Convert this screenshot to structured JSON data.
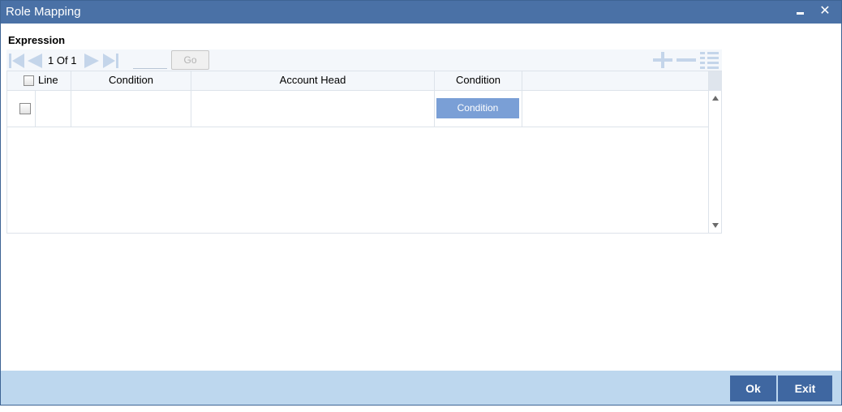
{
  "window": {
    "title": "Role Mapping",
    "minimize_icon": "minimize-icon",
    "close_icon": "close-icon",
    "close_glyph": "✕"
  },
  "section": {
    "title": "Expression"
  },
  "navigation": {
    "current_page": "1",
    "of_label": "Of",
    "total_pages": "1",
    "page_input_value": "",
    "go_label": "Go"
  },
  "grid": {
    "columns": [
      "Line",
      "Condition",
      "Account Head",
      "Condition"
    ],
    "rows": [
      {
        "line": "",
        "condition": "",
        "account_head": "",
        "condition_button": "Condition"
      }
    ]
  },
  "footer": {
    "ok_label": "Ok",
    "exit_label": "Exit"
  },
  "colors": {
    "titlebar": "#4a71a6",
    "footer": "#bdd7ee",
    "footer_button": "#3f67a1",
    "condition_button": "#7a9fd6"
  }
}
